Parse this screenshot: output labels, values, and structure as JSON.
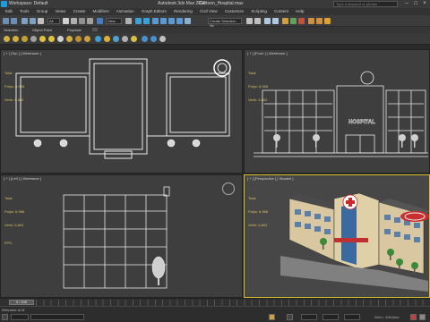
{
  "titlebar": {
    "workspace": "Workspace: Default",
    "app_name": "Autodesk 3ds Max 2016",
    "file_name": "Cartoon_Hospital.max",
    "search_placeholder": "Type a keyword or phrase",
    "window_controls": [
      "–",
      "□",
      "×"
    ]
  },
  "menubar": {
    "items": [
      "Edit",
      "Tools",
      "Group",
      "Views",
      "Create",
      "Modifiers",
      "Animation",
      "Graph Editors",
      "Rendering",
      "Civil View",
      "Customize",
      "Scripting",
      "Content",
      "Help"
    ]
  },
  "toolbar": {
    "filter_dropdown": "All",
    "view_dropdown": "View",
    "selection_set_placeholder": "Create Selection Se"
  },
  "ribbon": {
    "items": [
      "Selection",
      "Object Paint",
      "Populate"
    ]
  },
  "viewports": {
    "top": {
      "label": "[ + ] [Top ] [ Wireframe ]",
      "stats": {
        "total": "Total",
        "polys_label": "Polys:",
        "polys": "6,968",
        "verts_label": "Verts:",
        "verts": "6,602"
      }
    },
    "front": {
      "label": "[ + ] [Front ] [ Wireframe ]",
      "stats": {
        "total": "Total",
        "polys_label": "Polys:",
        "polys": "6,968",
        "verts_label": "Verts:",
        "verts": "6,602"
      },
      "sign_text": "HOSPITAL"
    },
    "left": {
      "label": "[ + ] [Left ] [ Wireframe ]",
      "stats": {
        "total": "Total",
        "polys_label": "Polys:",
        "polys": "6,968",
        "verts_label": "Verts:",
        "verts": "6,602"
      },
      "fps": "FPS:"
    },
    "perspective": {
      "label": "[ + ] [Perspective ] [ Shaded ]",
      "stats": {
        "total": "Total",
        "polys_label": "Polys:",
        "polys": "6,968",
        "verts_label": "Verts:",
        "verts": "6,602"
      }
    }
  },
  "timeline": {
    "frame_display": "0 / 100"
  },
  "statusbar": {
    "grid": "Grid = 100,0cm",
    "welcome": "Welcome to M"
  },
  "colors": {
    "accent": "#1e9ad6",
    "active_viewport": "#d8c02a",
    "stats": "#d8c060"
  }
}
